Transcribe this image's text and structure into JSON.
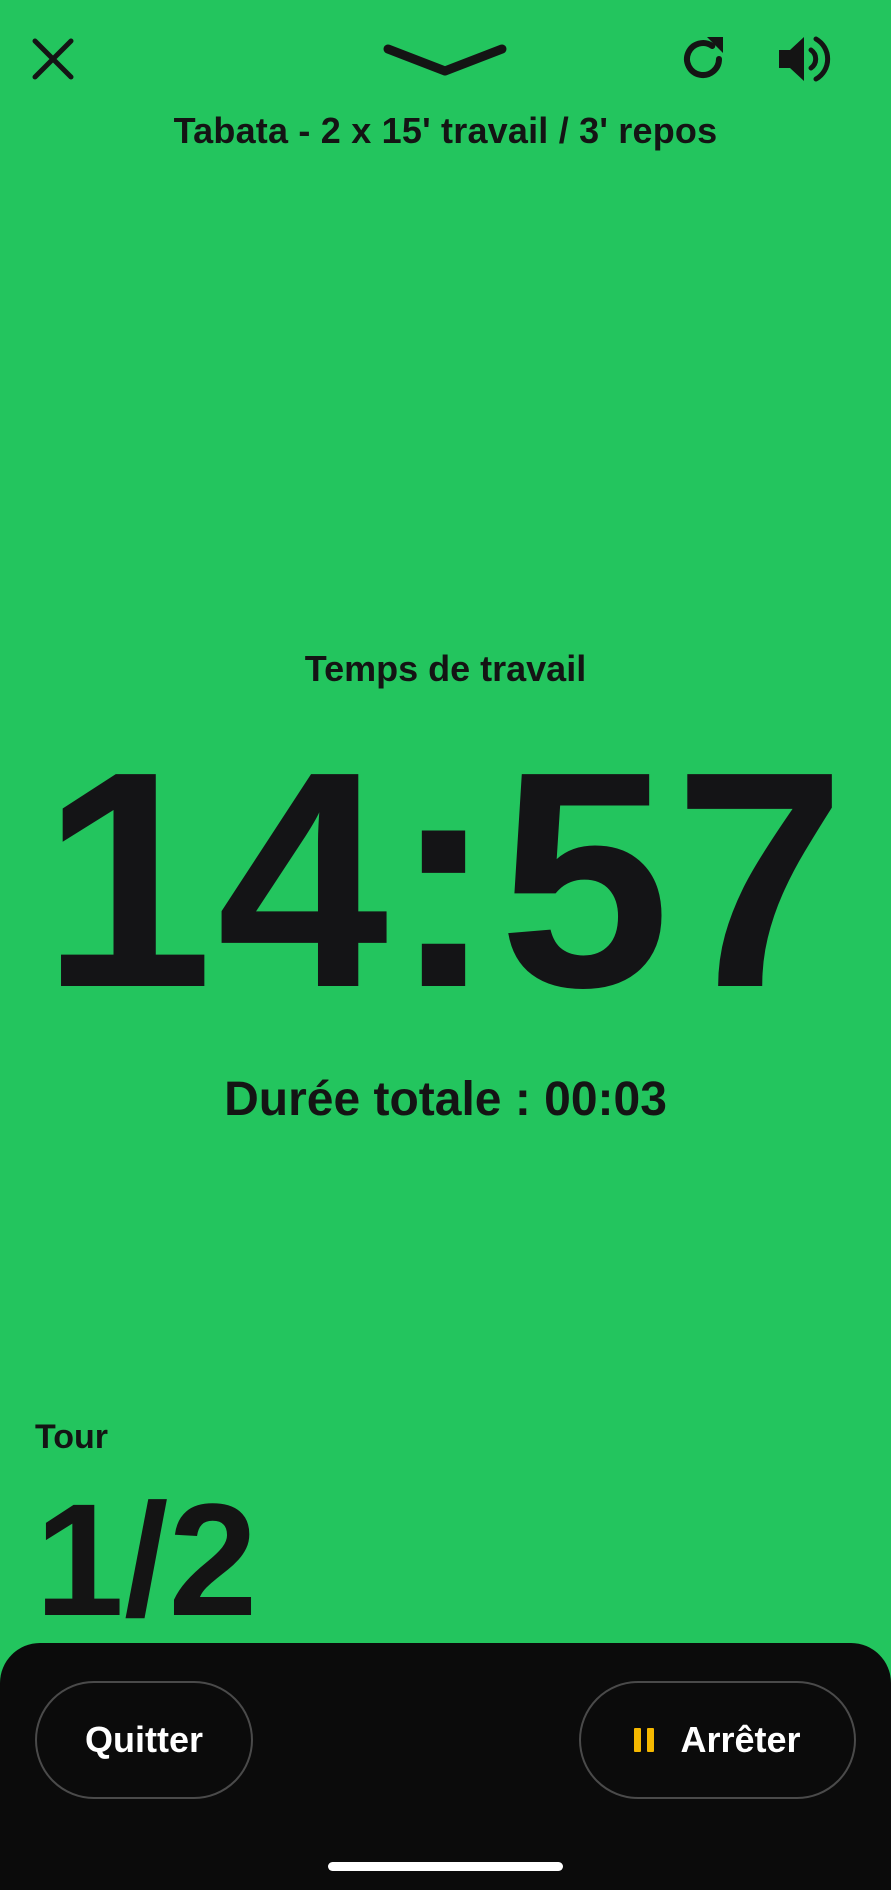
{
  "header": {
    "close_icon": "close-icon",
    "collapse_icon": "chevron-down-icon",
    "refresh_icon": "refresh-icon",
    "sound_icon": "volume-icon",
    "workout_title": "Tabata - 2 x 15' travail / 3' repos"
  },
  "timer": {
    "phase_label": "Temps de travail",
    "time": "14:57",
    "total_duration": "Durée totale : 00:03"
  },
  "round": {
    "label": "Tour",
    "value": "1/2"
  },
  "footer": {
    "quit_label": "Quitter",
    "stop_label": "Arrêter",
    "stop_icon": "pause-icon"
  },
  "colors": {
    "background": "#23c55e",
    "text": "#141414",
    "panel": "#0b0b0b",
    "accent": "#f5b800"
  }
}
